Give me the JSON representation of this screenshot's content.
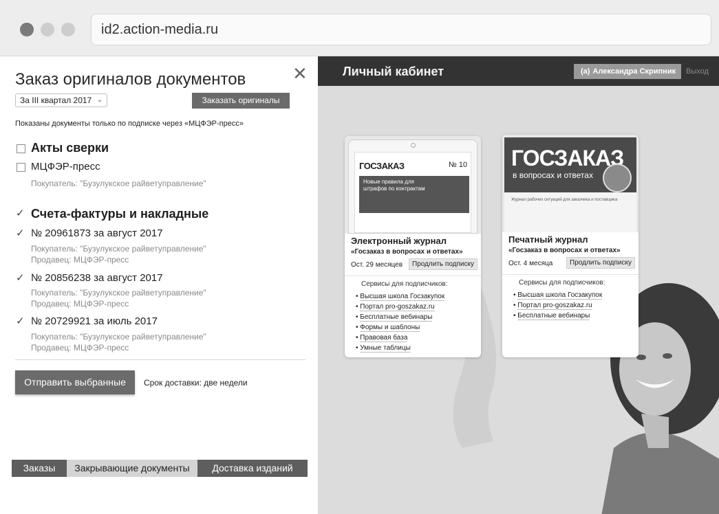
{
  "browser": {
    "url": "id2.action-media.ru"
  },
  "order_panel": {
    "title": "Заказ оригиналов документов",
    "close_glyph": "✕",
    "period": "За III квартал 2017",
    "order_button": "Заказать оригиналы",
    "note": "Показаны документы только по подписке через «МЦФЭР-пресс»",
    "groups": [
      {
        "title": "Акты сверки",
        "checked": false,
        "items": [
          {
            "title": "МЦФЭР-пресс",
            "checked": false,
            "buyer": "Покупатель: \"Бузулукское райветуправление\"",
            "seller": ""
          }
        ]
      },
      {
        "title": "Счета-фактуры и накладные",
        "checked": true,
        "items": [
          {
            "title": "№ 20961873 за август 2017",
            "checked": true,
            "buyer": "Покупатель: \"Бузулукское райветуправление\"",
            "seller": "Продавец: МЦФЭР-пресс"
          },
          {
            "title": "№ 20856238 за август 2017",
            "checked": true,
            "buyer": "Покупатель: \"Бузулукское райветуправление\"",
            "seller": "Продавец: МЦФЭР-пресс"
          },
          {
            "title": "№ 20729921 за июль 2017",
            "checked": true,
            "buyer": "Покупатель: \"Бузулукское райветуправление\"",
            "seller": "Продавец: МЦФЭР-пресс"
          }
        ]
      }
    ],
    "send_button": "Отправить выбранные",
    "delivery": "Срок доставки: две недели",
    "tabs": [
      "Заказы",
      "Закрывающие документы",
      "Доставка изданий"
    ],
    "active_tab": "Закрывающие документы"
  },
  "cabinet": {
    "title": "Личный кабинет",
    "user_mark": "(а)",
    "user_name": "Александра Скрипник",
    "logout": "Выход",
    "cards": [
      {
        "name": "Электронный журнал",
        "subtitle": "«Госзаказ в вопросах и ответах»",
        "remaining": "Ост. 29 месяцев",
        "renew": "Продлить подписку",
        "cover": {
          "logo": "ГОСЗАКАЗ",
          "issue": "№ 10",
          "headline": "Новые правила для штрафов по контрактам"
        },
        "services_title": "Сервисы для подписчиков:",
        "services": [
          "Высшая школа Госзакупок",
          "Портал pro-goszakaz.ru",
          "Бесплатные вебинары",
          "Формы и шаблоны",
          "Правовая база",
          "Умные таблицы"
        ]
      },
      {
        "name": "Печатный журнал",
        "subtitle": "«Госзаказ в вопросах и ответах»",
        "remaining": "Ост. 4 месяца",
        "renew": "Продлить подписку",
        "cover": {
          "logo": "ГОСЗАКАЗ",
          "sub": "в вопросах и ответах",
          "line": "Журнал рабочих ситуаций для заказчика и поставщика"
        },
        "services_title": "Сервисы для подписчиков:",
        "services": [
          "Высшая школа Госзакупок",
          "Портал pro-goszakaz.ru",
          "Бесплатные вебинары"
        ]
      }
    ]
  },
  "colors": {
    "header_dark": "#333333",
    "button_gray": "#6b6b6b",
    "panel_bg": "#dcdcdc"
  }
}
